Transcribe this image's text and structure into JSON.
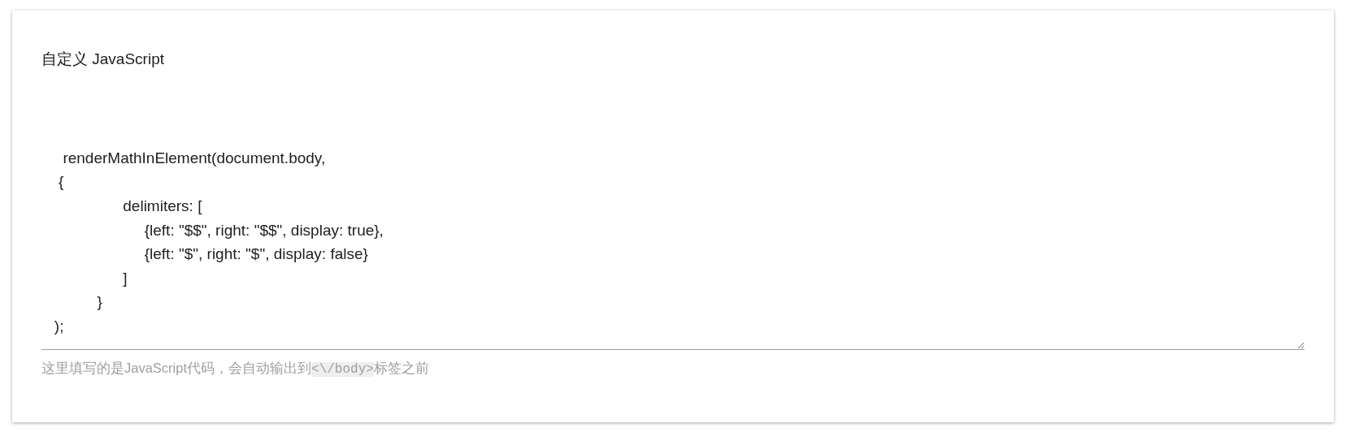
{
  "field": {
    "label": "自定义 JavaScript",
    "value": "\n\n\n     renderMathInElement(document.body,\n    {\n                   delimiters: [\n                        {left: \"$$\", right: \"$$\", display: true},\n                        {left: \"$\", right: \"$\", display: false}\n                   ]\n             }\n   );"
  },
  "hint": {
    "text_before": "这里填写的是JavaScript代码，会自动输出到",
    "code": "<\\/body>",
    "text_after": "标签之前"
  }
}
